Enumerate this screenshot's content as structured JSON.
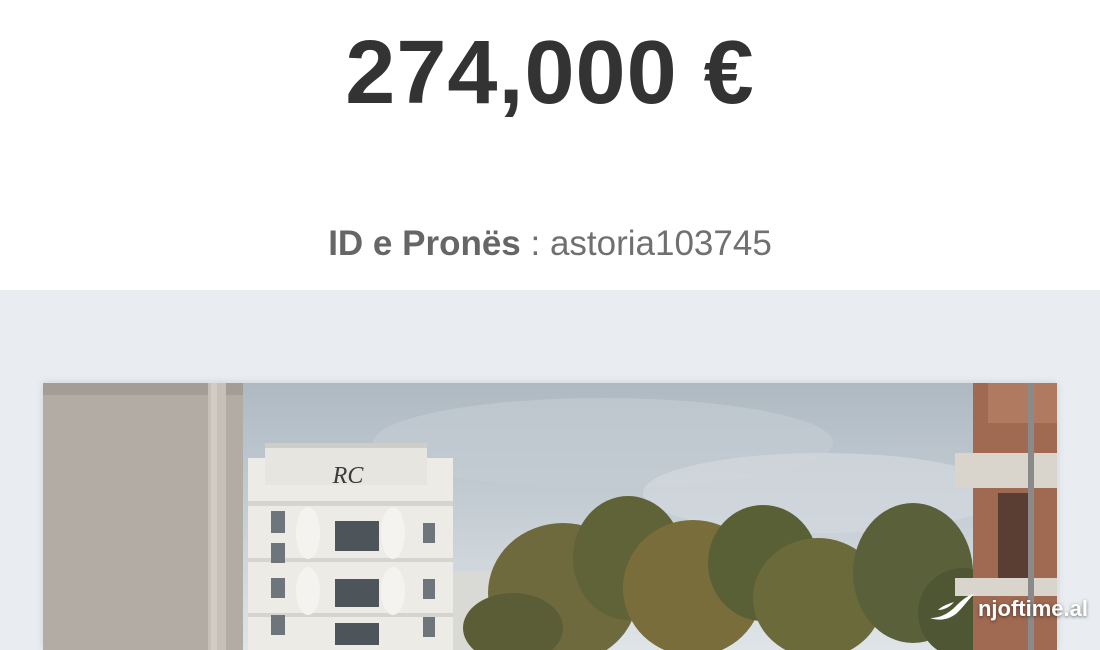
{
  "listing": {
    "price": "274,000 €",
    "property_id_label": "ID e Pronës",
    "property_id_separator": " : ",
    "property_id_value": "astoria103745"
  },
  "photo": {
    "building_monogram": "RC"
  },
  "watermark": {
    "text": "njoftime.al"
  }
}
